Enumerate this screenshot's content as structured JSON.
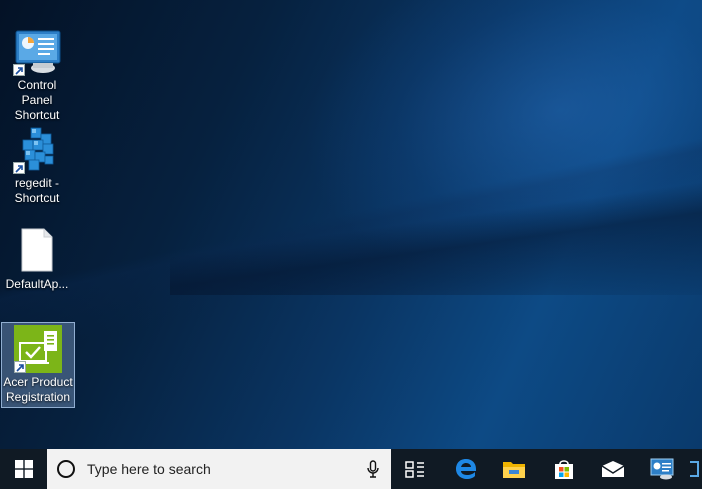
{
  "desktop": {
    "icons": [
      {
        "label": "Control Panel Shortcut",
        "icon": "control-panel-icon"
      },
      {
        "label": "regedit - Shortcut",
        "icon": "regedit-icon"
      },
      {
        "label": "DefaultAp...",
        "icon": "blank-file-icon"
      },
      {
        "label": "Acer Product Registration",
        "icon": "acer-registration-icon"
      }
    ]
  },
  "taskbar": {
    "search": {
      "placeholder": "Type here to search"
    },
    "pinned": [
      "task-view-icon",
      "edge-icon",
      "file-explorer-icon",
      "store-icon",
      "mail-icon",
      "control-panel-icon"
    ]
  },
  "colors": {
    "taskbar": "#101a24",
    "search_box": "#f2f2f2",
    "edge_blue": "#1e88e5",
    "acer_green": "#7cb518"
  }
}
